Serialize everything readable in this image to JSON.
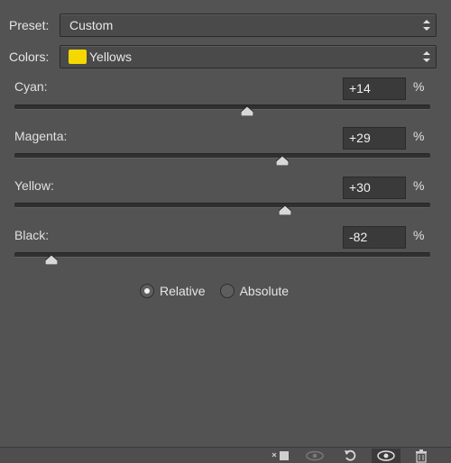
{
  "preset": {
    "label": "Preset:",
    "value": "Custom"
  },
  "colors": {
    "label": "Colors:",
    "value": "Yellows",
    "swatch_color": "#f5d800"
  },
  "sliders": [
    {
      "label": "Cyan:",
      "value": "+14",
      "unit": "%",
      "level_pct": 56
    },
    {
      "label": "Magenta:",
      "value": "+29",
      "unit": "%",
      "level_pct": 64.5
    },
    {
      "label": "Yellow:",
      "value": "+30",
      "unit": "%",
      "level_pct": 65
    },
    {
      "label": "Black:",
      "value": "-82",
      "unit": "%",
      "level_pct": 9
    }
  ],
  "method": {
    "options": [
      {
        "label": "Relative",
        "selected": true
      },
      {
        "label": "Absolute",
        "selected": false
      }
    ]
  },
  "bottom_bar": {
    "icons": [
      "clip-to-layer-icon",
      "view-previous-state-icon",
      "reset-icon",
      "toggle-visibility-icon",
      "delete-icon"
    ]
  }
}
